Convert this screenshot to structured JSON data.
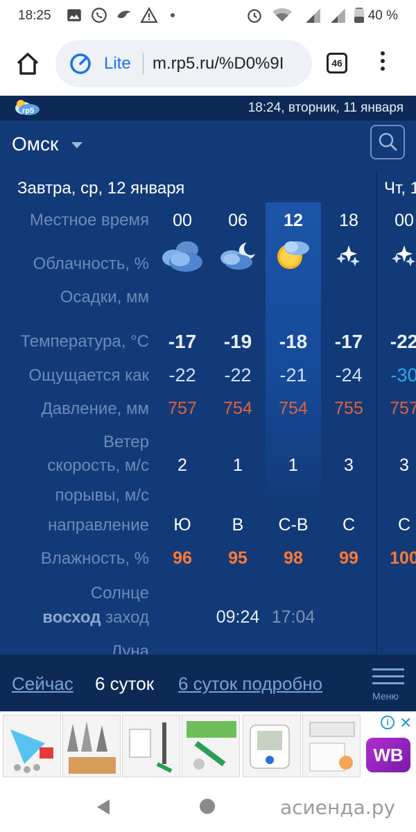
{
  "status": {
    "time": "18:25",
    "battery": "40 %"
  },
  "browser": {
    "mode": "Lite",
    "url": "m.rp5.ru/%D0%9I",
    "tab_count": "46"
  },
  "site": {
    "logo": "rp5",
    "datetime": "18:24, вторник, 11 января",
    "city": "Омск"
  },
  "forecast": {
    "day_title": "Завтра, ср, 12 января",
    "next_day_title": "Чт, 1",
    "labels": {
      "local_time": "Местное время",
      "cloudiness": "Облачность, %",
      "precip": "Осадки, мм",
      "temp": "Температура, °C",
      "feels": "Ощущается как",
      "pressure": "Давление, мм",
      "wind": "Ветер",
      "wind_speed": "скорость, м/с",
      "gusts": "порывы, м/с",
      "direction": "направление",
      "humidity": "Влажность, %",
      "sun": "Солнце",
      "sunrise_label": "восход",
      "sunset_label": "заход",
      "moon": "Луна"
    },
    "hours": [
      "00",
      "06",
      "12",
      "18",
      "00"
    ],
    "temps": [
      "-17",
      "-19",
      "-18",
      "-17",
      "-22"
    ],
    "feels": [
      "-22",
      "-22",
      "-21",
      "-24",
      "-30"
    ],
    "pressure": [
      "757",
      "754",
      "754",
      "755",
      "757"
    ],
    "wind_speed": [
      "2",
      "1",
      "1",
      "3",
      "3"
    ],
    "direction": [
      "Ю",
      "В",
      "С-В",
      "С",
      "С"
    ],
    "humidity": [
      "96",
      "95",
      "98",
      "99",
      "100"
    ],
    "sunrise": "09:24",
    "sunset": "17:04",
    "icons": [
      "cloudy-night-icon",
      "cloudy-moon-icon",
      "sun-cloud-icon",
      "clear-night-stars-icon",
      "clear-night-stars-icon"
    ]
  },
  "bottom_nav": {
    "now": "Сейчас",
    "six_days": "6 суток",
    "six_days_detailed": "6 суток подробно",
    "menu": "Меню"
  },
  "ads": {
    "banner_text": "WB",
    "info": "i",
    "close": "✕"
  },
  "watermark": "асиенда.ру",
  "colors": {
    "weather_bg": "#123a78",
    "header_bg": "#0d2a57",
    "pressure": "#e2633a",
    "humidity": "#ff7a32",
    "feels_cold": "#29a8f0"
  }
}
